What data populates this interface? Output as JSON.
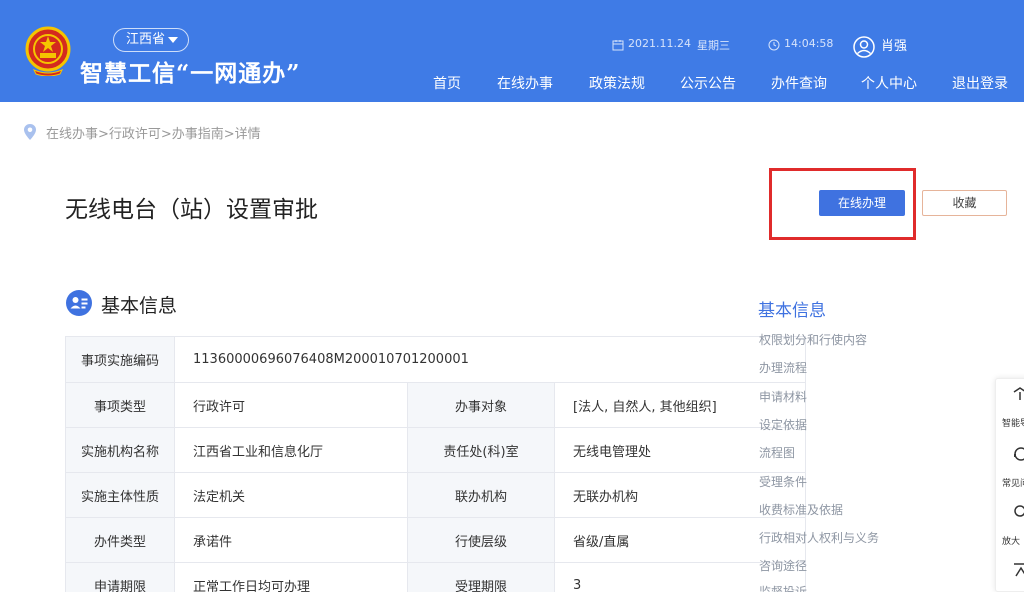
{
  "header": {
    "province": "江西省",
    "title": "智慧工信“一网通办”",
    "date": "2021.11.24",
    "weekday": "星期三",
    "time": "14:04:58",
    "user_name": "肖强",
    "nav": [
      "首页",
      "在线办事",
      "政策法规",
      "公示公告",
      "办件查询",
      "个人中心",
      "退出登录"
    ]
  },
  "breadcrumb": "在线办事>行政许可>办事指南>详情",
  "page": {
    "title": "无线电台（站）设置审批",
    "primary_button": "在线办理",
    "secondary_button": "收藏"
  },
  "section": {
    "title": "基本信息"
  },
  "info_table": {
    "rows": [
      {
        "label1": "事项实施编码",
        "value1": "11360000696076408M200010701200001"
      },
      {
        "label1": "事项类型",
        "value1": "行政许可",
        "label2": "办事对象",
        "value2": "[法人, 自然人, 其他组织]"
      },
      {
        "label1": "实施机构名称",
        "value1": "江西省工业和信息化厅",
        "label2": "责任处(科)室",
        "value2": "无线电管理处"
      },
      {
        "label1": "实施主体性质",
        "value1": "法定机关",
        "label2": "联办机构",
        "value2": "无联办机构"
      },
      {
        "label1": "办件类型",
        "value1": "承诺件",
        "label2": "行使层级",
        "value2": "省级/直属"
      },
      {
        "label1": "申请期限",
        "value1": "正常工作日均可办理",
        "label2": "受理期限",
        "value2": "3"
      }
    ]
  },
  "side_nav": {
    "active": "基本信息",
    "items": [
      "权限划分和行使内容",
      "办理流程",
      "申请材料",
      "设定依据",
      "流程图",
      "受理条件",
      "收费标准及依据",
      "行政相对人权利与义务",
      "咨询途径",
      "监督投诉"
    ]
  },
  "float_bar": {
    "items": [
      "智能导",
      "常见问",
      "放大"
    ]
  },
  "colors": {
    "header_bg": "#3f7be6",
    "primary": "#3f72e0",
    "highlight": "#e02b2b"
  }
}
